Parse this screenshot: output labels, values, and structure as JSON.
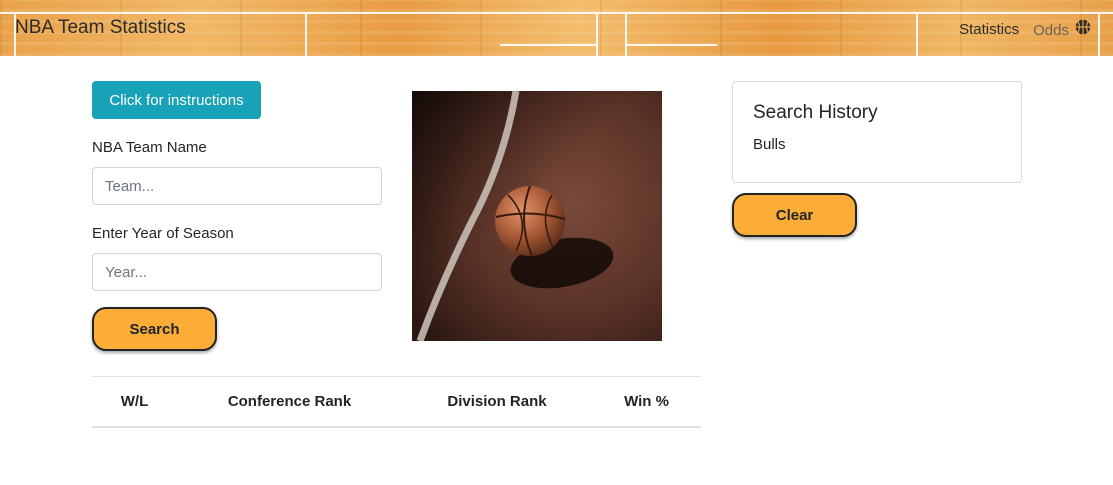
{
  "navbar": {
    "brand": "NBA Team Statistics",
    "links": [
      "Statistics",
      "Odds"
    ]
  },
  "form": {
    "instructions_button": "Click for instructions",
    "team_label": "NBA Team Name",
    "team_placeholder": "Team...",
    "year_label": "Enter Year of Season",
    "year_placeholder": "Year...",
    "search_button": "Search"
  },
  "table": {
    "headers": [
      "W/L",
      "Conference Rank",
      "Division Rank",
      "Win %"
    ]
  },
  "history": {
    "title": "Search History",
    "items": [
      "Bulls"
    ],
    "clear_button": "Clear"
  },
  "colors": {
    "accent_teal": "#17a2b8",
    "button_yellow": "#fbad38",
    "wood": "#eaa54c"
  },
  "icons": {
    "basketball": "basketball-icon"
  }
}
